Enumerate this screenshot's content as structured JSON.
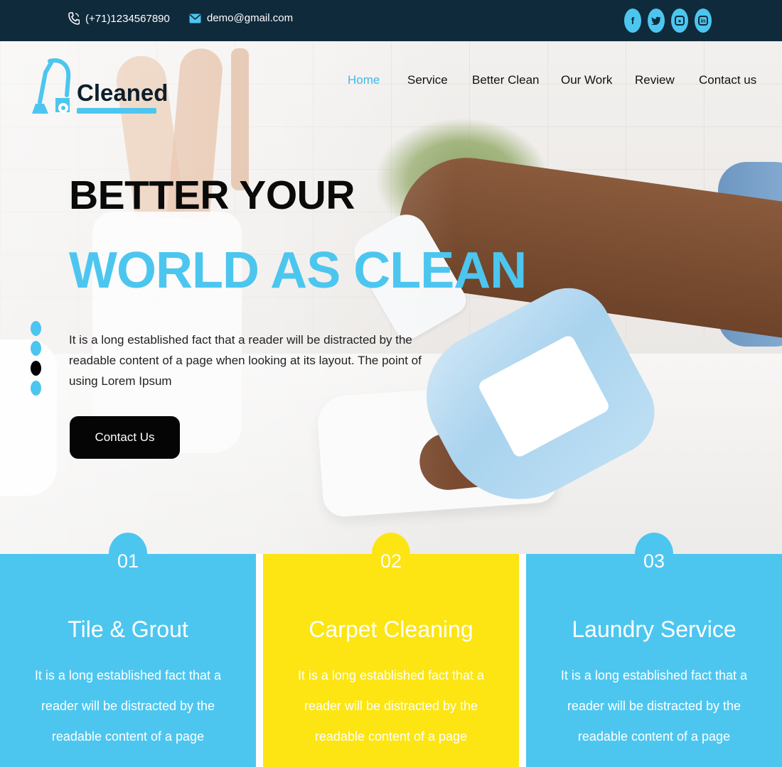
{
  "topbar": {
    "phone": "(+71)1234567890",
    "email": "demo@gmail.com",
    "socials": [
      "facebook-icon",
      "twitter-icon",
      "instagram-icon",
      "linkedin-icon"
    ],
    "social_glyphs": [
      "f",
      "t",
      "",
      "in"
    ]
  },
  "brand": {
    "name": "Cleaned",
    "icon": "vacuum-cleaner-icon"
  },
  "nav": {
    "items": [
      "Home",
      "Service",
      "Better Clean",
      "Our Work",
      "Review",
      "Contact us"
    ],
    "active": "Home"
  },
  "hero": {
    "line1": "BETTER YOUR",
    "line2": "WORLD AS CLEAN",
    "paragraph": "It is a long established fact that a reader will be distracted by the readable content of a page when looking at its layout. The point of using Lorem Ipsum",
    "cta": "Contact Us",
    "slides": 4,
    "active_slide": 3
  },
  "services": [
    {
      "number": "01",
      "title": "Tile & Grout",
      "text": "It is a long established fact that a reader will be distracted by the readable content of a page",
      "color": "#4cc6ef"
    },
    {
      "number": "02",
      "title": "Carpet Cleaning",
      "text": "It is a long established fact that a reader will be distracted by the readable content of a page",
      "color": "#fce512"
    },
    {
      "number": "03",
      "title": "Laundry Service",
      "text": "It is a long established fact that a reader will be distracted by the readable content of a page",
      "color": "#4cc6ef"
    }
  ],
  "colors": {
    "accent": "#4cc6ef",
    "yellow": "#fce512",
    "topbar": "#0f2a3b",
    "dark": "#050505"
  }
}
